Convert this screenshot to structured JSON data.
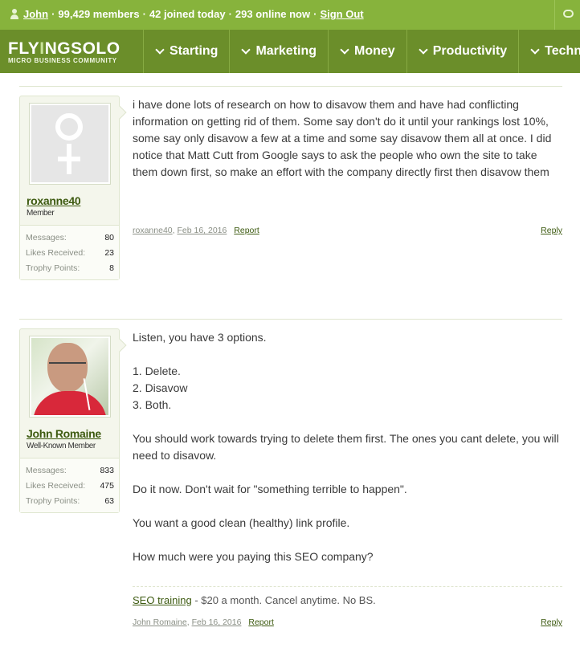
{
  "topbar": {
    "username": "John",
    "members": "99,429 members",
    "joined": "42 joined today",
    "online": "293 online now",
    "sign_out": "Sign Out"
  },
  "logo": {
    "brand_a": "FLY",
    "brand_accent": "I",
    "brand_b": "NG",
    "brand_c": "SOLO",
    "tagline": "MICRO BUSINESS COMMUNITY"
  },
  "nav": {
    "items": [
      "Starting",
      "Marketing",
      "Money",
      "Productivity",
      "Technology"
    ]
  },
  "posts": [
    {
      "user": {
        "name": "roxanne40",
        "title": "Member",
        "messages_label": "Messages:",
        "messages": "80",
        "likes_label": "Likes Received:",
        "likes": "23",
        "trophy_label": "Trophy Points:",
        "trophy": "8"
      },
      "paragraphs": [
        "i have done lots of research on how to disavow them and have had conflicting information on getting rid of them. Some say don't do it until your rankings lost 10%, some say only disavow a few at a time and some say disavow them all at once. I did notice that Matt Cutt from Google says to ask the people who own the site to take them down first, so make an effort with the company directly first then disavow them"
      ],
      "meta": {
        "author": "roxanne40",
        "date": "Feb 16, 2016",
        "report": "Report",
        "reply": "Reply"
      }
    },
    {
      "user": {
        "name": "John Romaine",
        "title": "Well-Known Member",
        "messages_label": "Messages:",
        "messages": "833",
        "likes_label": "Likes Received:",
        "likes": "475",
        "trophy_label": "Trophy Points:",
        "trophy": "63"
      },
      "intro": "Listen, you have 3 options.",
      "options": [
        "1. Delete.",
        "2. Disavow",
        "3. Both."
      ],
      "paragraphs": [
        "You should work towards trying to delete them first. The ones you cant delete, you will need to disavow.",
        "Do it now. Don't wait for \"something terrible to happen\".",
        "You want a good clean (healthy) link profile.",
        "How much were you paying this SEO company?"
      ],
      "signature": {
        "link": "SEO training",
        "text": " - $20 a month. Cancel anytime. No BS."
      },
      "meta": {
        "author": "John Romaine",
        "date": "Feb 16, 2016",
        "report": "Report",
        "reply": "Reply"
      }
    }
  ]
}
